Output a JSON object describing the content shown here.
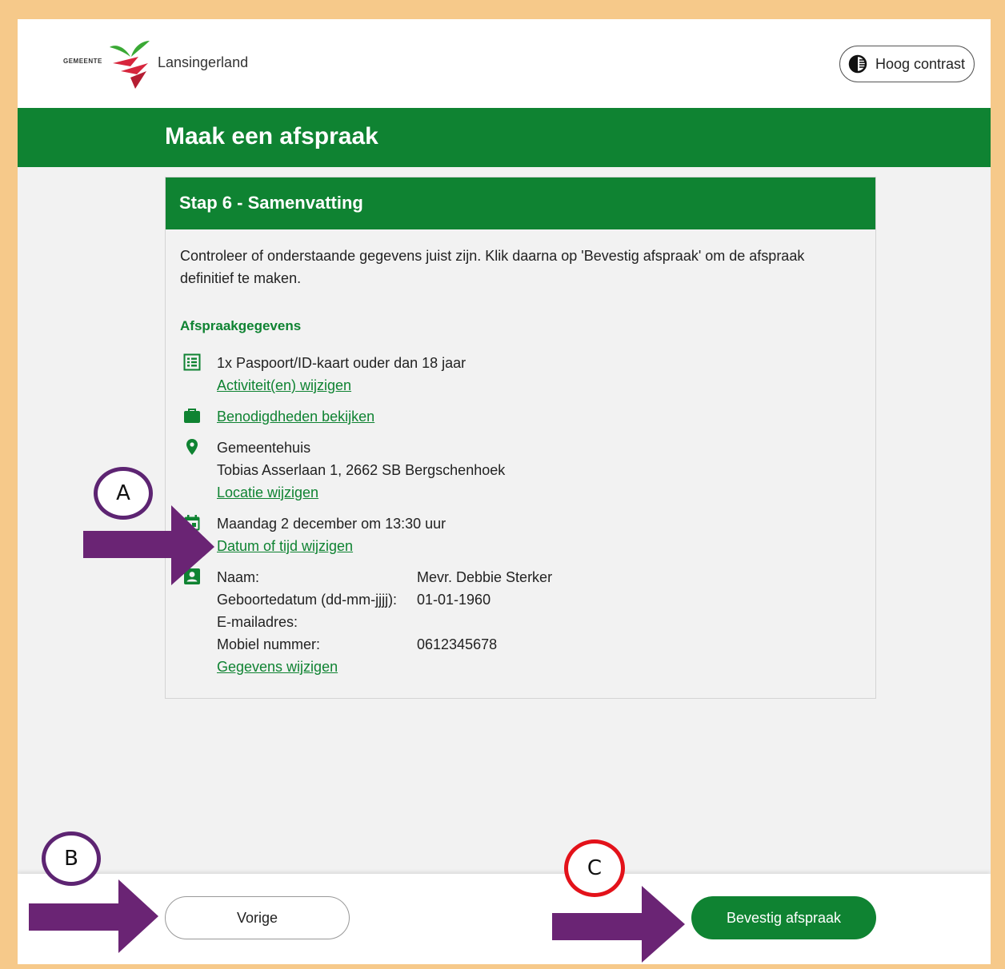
{
  "header": {
    "logo_prefix": "GEMEENTE",
    "logo_name": "Lansingerland",
    "contrast_label": "Hoog contrast"
  },
  "banner": {
    "title": "Maak een afspraak"
  },
  "card": {
    "title": "Stap 6 - Samenvatting",
    "intro": "Controleer of onderstaande gegevens juist zijn. Klik daarna op 'Bevestig afspraak' om de afspraak definitief te maken.",
    "section_title": "Afspraakgegevens",
    "activity": {
      "text": "1x Paspoort/ID-kaart ouder dan 18 jaar",
      "link": "Activiteit(en) wijzigen"
    },
    "requirements": {
      "link": "Benodigdheden bekijken"
    },
    "location": {
      "name": "Gemeentehuis",
      "address": "Tobias Asserlaan 1, 2662 SB Bergschenhoek",
      "link": "Locatie wijzigen"
    },
    "datetime": {
      "text": "Maandag 2 december om 13:30 uur",
      "link": "Datum of tijd wijzigen"
    },
    "person": {
      "rows": [
        {
          "label": "Naam:",
          "value": "Mevr. Debbie Sterker"
        },
        {
          "label": "Geboortedatum (dd-mm-jjjj):",
          "value": "01-01-1960"
        },
        {
          "label": "E-mailadres:",
          "value": ""
        },
        {
          "label": "Mobiel nummer:",
          "value": "0612345678"
        }
      ],
      "link": "Gegevens wijzigen"
    }
  },
  "footer": {
    "prev_label": "Vorige",
    "confirm_label": "Bevestig afspraak"
  },
  "annotations": {
    "a": "A",
    "b": "B",
    "c": "C"
  },
  "colors": {
    "primary_green": "#0f8332",
    "annotation_purple": "#5d2472",
    "annotation_red": "#e3121a",
    "frame_orange": "#f6c98a"
  }
}
